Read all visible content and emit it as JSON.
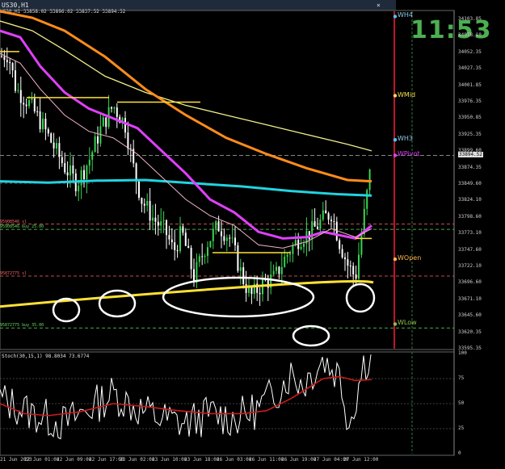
{
  "window": {
    "title": "US30,H1",
    "ohlc": "US30,H1  33858.02 33896.02 33837.52 33894.52",
    "clock": "11:53",
    "close_glyph": "×"
  },
  "price_axis": {
    "labels": [
      "34103.85",
      "34078.10",
      "34052.35",
      "34027.35",
      "34001.85",
      "33976.35",
      "33950.85",
      "33925.35",
      "33899.60",
      "33874.35",
      "33849.60",
      "33824.10",
      "33798.60",
      "33773.10",
      "33747.60",
      "33722.10",
      "33696.60",
      "33671.10",
      "33645.60",
      "33620.35",
      "33595.35"
    ],
    "current_price": "33894.52"
  },
  "levels": [
    {
      "name": "WH4",
      "price": 34102,
      "color": "#8ecae6",
      "dot": "#4fc3f7"
    },
    {
      "name": "WMid",
      "price": 33980,
      "color": "#f4e04d",
      "dot": "#f4e04d"
    },
    {
      "name": "WH3",
      "price": 33912,
      "color": "#8ecae6",
      "dot": "#4fc3f7"
    },
    {
      "name": "WPivot",
      "price": 33888,
      "color": "#e040fb",
      "dot": "#e040fb"
    },
    {
      "name": "WOpen",
      "price": 33728,
      "color": "#ffb74d",
      "dot": "#ffb74d"
    },
    {
      "name": "WLow",
      "price": 33628,
      "color": "#8bc34a",
      "dot": "#8bc34a"
    }
  ],
  "order_tags": [
    {
      "text": "95908546 sl",
      "price": 33782,
      "color": "#ff6666"
    },
    {
      "text": "95908546 buy 25.00",
      "price": 33774,
      "color": "#66dd66"
    },
    {
      "text": "95872775 sl",
      "price": 33702,
      "color": "#ff6666"
    },
    {
      "text": "95872775 buy 35.00",
      "price": 33622,
      "color": "#66dd66"
    }
  ],
  "time_axis": {
    "labels": [
      "21 Jun 2023",
      "22 Jun 01:00",
      "22 Jun 09:00",
      "22 Jun 17:00",
      "23 Jun 02:00",
      "23 Jun 10:00",
      "23 Jun 18:00",
      "26 Jun 03:00",
      "26 Jun 11:00",
      "26 Jun 19:00",
      "27 Jun 04:00",
      "27 Jun 12:00"
    ]
  },
  "oscillator": {
    "title": "Stoch(30,15,1) 98.8034 73.6774",
    "levels": [
      "100",
      "75",
      "50",
      "25",
      "0"
    ],
    "main": 98.8034,
    "signal": 73.6774
  },
  "colors": {
    "bull": "#39d353",
    "bear": "#ffffff",
    "ma_orange": "#ff8c1a",
    "ma_yellow": "#f2ee8a",
    "ma_cyan": "#21d4e0",
    "ma_magenta": "#e040fb",
    "ma_pink": "#f0b4c8",
    "trendline": "#ffe135",
    "stoch_main": "#ffffff",
    "stoch_signal": "#cc1b1b"
  }
}
